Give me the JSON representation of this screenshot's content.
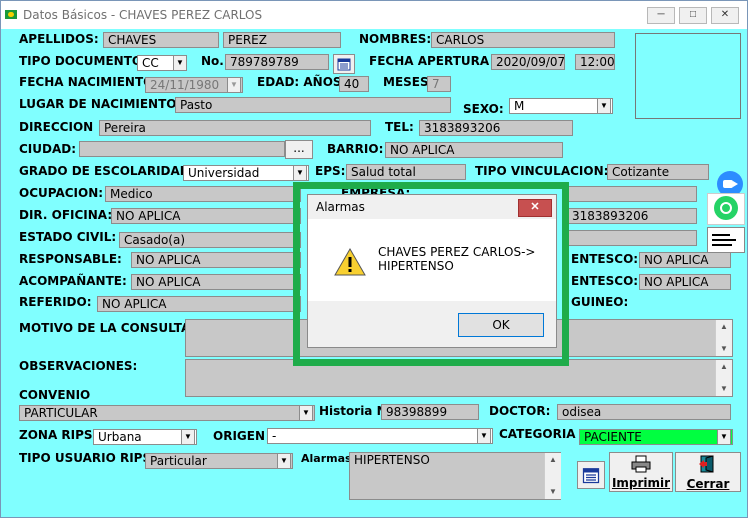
{
  "window": {
    "title": "Datos Básicos - CHAVES PEREZ CARLOS"
  },
  "labels": {
    "apellidos": "APELLIDOS:",
    "nombres": "NOMBRES:",
    "tipo_documento": "TIPO DOCUMENTO",
    "no": "No.",
    "fecha_apertura": "FECHA APERTURA",
    "fecha_nacimiento": "FECHA NACIMIENTO:",
    "edad_anos": "EDAD: AÑOS",
    "meses": "MESES",
    "lugar_nacimiento": "LUGAR DE NACIMIENTO:",
    "sexo": "SEXO:",
    "direccion": "DIRECCION",
    "tel": "TEL:",
    "ciudad": "CIUDAD:",
    "barrio": "BARRIO:",
    "grado_escolaridad": "GRADO DE ESCOLARIDAD:",
    "eps": "EPS:",
    "tipo_vinculacion": "TIPO VINCULACION:",
    "ocupacion": "OCUPACION:",
    "empresa": "EMPRESA:",
    "dir_oficina": "DIR. OFICINA:",
    "estado_civil": "ESTADO CIVIL:",
    "responsable": "RESPONSABLE:",
    "parentesco1": "ENTESCO:",
    "acompanante": "ACOMPAÑANTE:",
    "parentesco2": "ENTESCO:",
    "referido": "REFERIDO:",
    "sanguineo": "GUINEO:",
    "motivo": "MOTIVO DE LA CONSULTA:",
    "observaciones": "OBSERVACIONES:",
    "convenio": "CONVENIO",
    "historia": "Historia No",
    "doctor": "DOCTOR:",
    "zona_rips": "ZONA RIPS",
    "origen": "ORIGEN",
    "categoria": "CATEGORIA",
    "tipo_usuario": "TIPO USUARIO RIPS",
    "alarmas": "Alarmas"
  },
  "values": {
    "apellido1": "CHAVES",
    "apellido2": "PEREZ",
    "nombres": "CARLOS",
    "tipo_documento": "CC",
    "numero": "789789789",
    "fecha_apertura": "2020/09/07",
    "hora_apertura": "12:00",
    "fecha_nacimiento": "24/11/1980",
    "edad_anos": "40",
    "meses": "7",
    "lugar_nacimiento": "Pasto",
    "sexo": "M",
    "direccion": "Pereira",
    "tel": "3183893206",
    "ciudad": "",
    "barrio": "NO APLICA",
    "escolaridad": "Universidad",
    "eps": "Salud total",
    "tipo_vinculacion": "Cotizante",
    "ocupacion": "Medico",
    "empresa": "",
    "dir_oficina": "NO APLICA",
    "tel_oficina": "3183893206",
    "estado_civil": "Casado(a)",
    "responsable": "NO APLICA",
    "parentesco_resp": "NO APLICA",
    "acompanante": "NO APLICA",
    "parentesco_acomp": "NO APLICA",
    "referido": "NO APLICA",
    "motivo": "",
    "observaciones": "",
    "convenio": "PARTICULAR",
    "historia": "98398899",
    "doctor": "odisea",
    "zona_rips": "Urbana",
    "origen": "-",
    "categoria": "PACIENTE",
    "tipo_usuario": "Particular",
    "alarmas": "HIPERTENSO"
  },
  "buttons": {
    "ciudad_browse": "...",
    "imprimir": "Imprimir",
    "cerrar": "Cerrar",
    "minimize": "─",
    "maximize": "□",
    "close": "✕",
    "dropdown": "▼",
    "scroll_up": "▲",
    "scroll_down": "▼"
  },
  "dialog": {
    "title": "Alarmas",
    "message": "CHAVES PEREZ CARLOS->\nHIPERTENSO",
    "ok": "OK",
    "close": "✕"
  },
  "colors": {
    "form_bg": "#80ffff",
    "highlight": "#1fac4a",
    "categoria_bg": "#00ff40",
    "whatsapp": "#25d366",
    "zoom": "#2d8cff"
  }
}
